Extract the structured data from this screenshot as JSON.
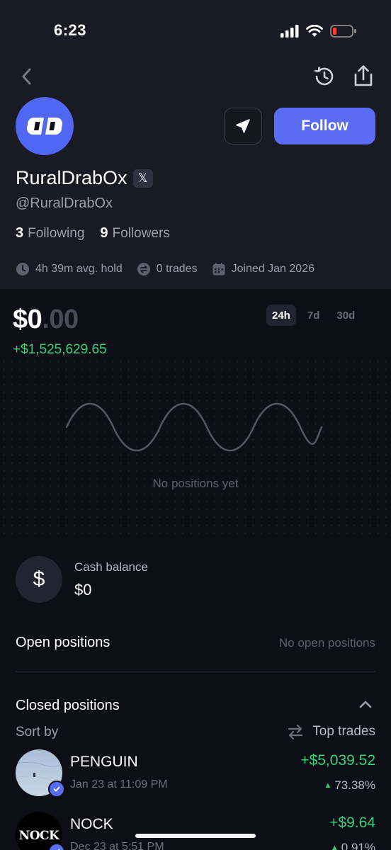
{
  "status": {
    "time": "6:23"
  },
  "profile": {
    "name": "RuralDrabOx",
    "handle": "@RuralDrabOx",
    "following_count": "3",
    "following_label": "Following",
    "followers_count": "9",
    "followers_label": "Followers",
    "follow_button": "Follow",
    "x_badge": "𝕏"
  },
  "stats": {
    "avg_hold": "4h 39m avg. hold",
    "trades": "0 trades",
    "joined": "Joined Jan 2026"
  },
  "portfolio": {
    "balance_whole": "$0",
    "balance_cents": ".00",
    "pnl": "+$1,525,629.65",
    "periods": [
      "24h",
      "7d",
      "30d"
    ],
    "active_period": "24h",
    "empty_message": "No positions yet"
  },
  "cash": {
    "icon_symbol": "$",
    "label": "Cash balance",
    "value": "$0"
  },
  "open_positions": {
    "title": "Open positions",
    "empty": "No open positions"
  },
  "closed_positions": {
    "title": "Closed positions",
    "sort_label": "Sort by",
    "sort_value": "Top trades",
    "trades": [
      {
        "name": "PENGUIN",
        "date": "Jan 23 at 11:09 PM",
        "pnl": "+$5,039.52",
        "pct": "73.38%"
      },
      {
        "name": "NOCK",
        "date": "Dec 23 at 5:51 PM",
        "pnl": "+$9.64",
        "pct": "0.91%",
        "logo_text": "NOCK"
      }
    ]
  },
  "colors": {
    "accent": "#5a6cf4",
    "positive": "#35d27a",
    "background": "#0d0e16",
    "header_bg": "#1a1a24"
  }
}
